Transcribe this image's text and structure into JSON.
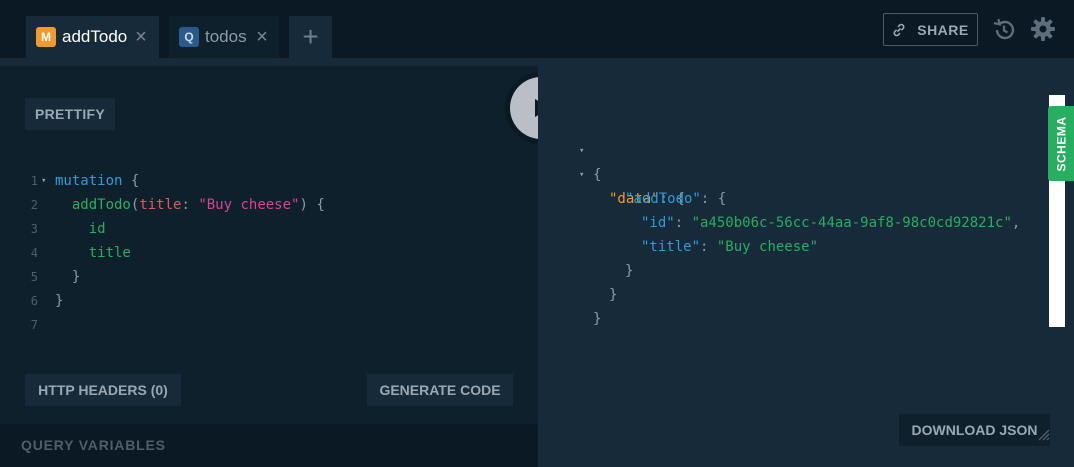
{
  "tabs": [
    {
      "badge": "M",
      "label": "addTodo",
      "active": true
    },
    {
      "badge": "Q",
      "label": "todos",
      "active": false
    }
  ],
  "tab_close_glyph": "×",
  "add_tab_glyph": "+",
  "toolbar": {
    "share_label": "SHARE",
    "icons": [
      "link-icon",
      "history-icon",
      "gear-icon"
    ]
  },
  "editor": {
    "prettify_label": "PRETTIFY",
    "lines": [
      {
        "n": "1",
        "folded": true
      },
      {
        "n": "2",
        "folded": false
      },
      {
        "n": "3",
        "folded": false
      },
      {
        "n": "4",
        "folded": false
      },
      {
        "n": "5",
        "folded": false
      },
      {
        "n": "6",
        "folded": false
      },
      {
        "n": "7",
        "folded": false
      }
    ],
    "code": {
      "kw_mutation": "mutation",
      "open_brace": " {",
      "fn_name": "addTodo",
      "paren_open": "(",
      "arg_name": "title",
      "colon": ": ",
      "arg_value": "\"Buy cheese\"",
      "paren_close": ") {",
      "field_id": "id",
      "field_title": "title",
      "close_inner": "}",
      "close_outer": "}"
    },
    "http_headers_label": "HTTP HEADERS (0)",
    "generate_code_label": "GENERATE CODE",
    "query_variables_label": "QUERY VARIABLES"
  },
  "result": {
    "open": "{",
    "data_key": "\"data\"",
    "addtodo_key": "\"addTodo\"",
    "id_key": "\"id\"",
    "id_value": "\"a450b06c-56cc-44aa-9af8-98c0cd92821c\"",
    "title_key": "\"title\"",
    "title_value": "\"Buy cheese\"",
    "colon_brace": ": {",
    "colon": ": ",
    "comma": ",",
    "close": "}",
    "schema_label": "SCHEMA",
    "download_label": "DOWNLOAD JSON"
  },
  "colors": {
    "accent_mutation": "#f09b2a",
    "schema_green": "#27ae60",
    "background": "#0f202d"
  }
}
